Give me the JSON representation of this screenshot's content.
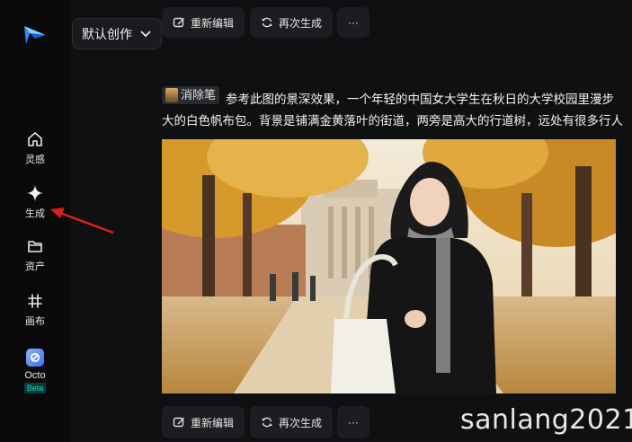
{
  "sidebar": {
    "items": [
      {
        "label": "灵感",
        "icon": "home-icon"
      },
      {
        "label": "生成",
        "icon": "sparkle-icon"
      },
      {
        "label": "资产",
        "icon": "folder-icon"
      },
      {
        "label": "画布",
        "icon": "canvas-icon"
      }
    ],
    "octo": {
      "label": "Octo",
      "badge": "Beta"
    }
  },
  "header": {
    "mode_label": "默认创作"
  },
  "top_actions": {
    "edit_label": "重新编辑",
    "regen_label": "再次生成",
    "more_label": "···"
  },
  "prompt": {
    "chip_label": "消除笔",
    "line1": "参考此图的景深效果，一个年轻的中国女大学生在秋日的大学校园里漫步",
    "line2": "大的白色帆布包。背景是铺满金黄落叶的街道，两旁是高大的行道树，远处有很多行人"
  },
  "bottom_actions": {
    "edit_label": "重新编辑",
    "regen_label": "再次生成",
    "more_label": "···"
  },
  "watermark": "sanlang2021",
  "colors": {
    "annotation_arrow": "#e01e1e",
    "beta_badge": "#21d4c4"
  }
}
